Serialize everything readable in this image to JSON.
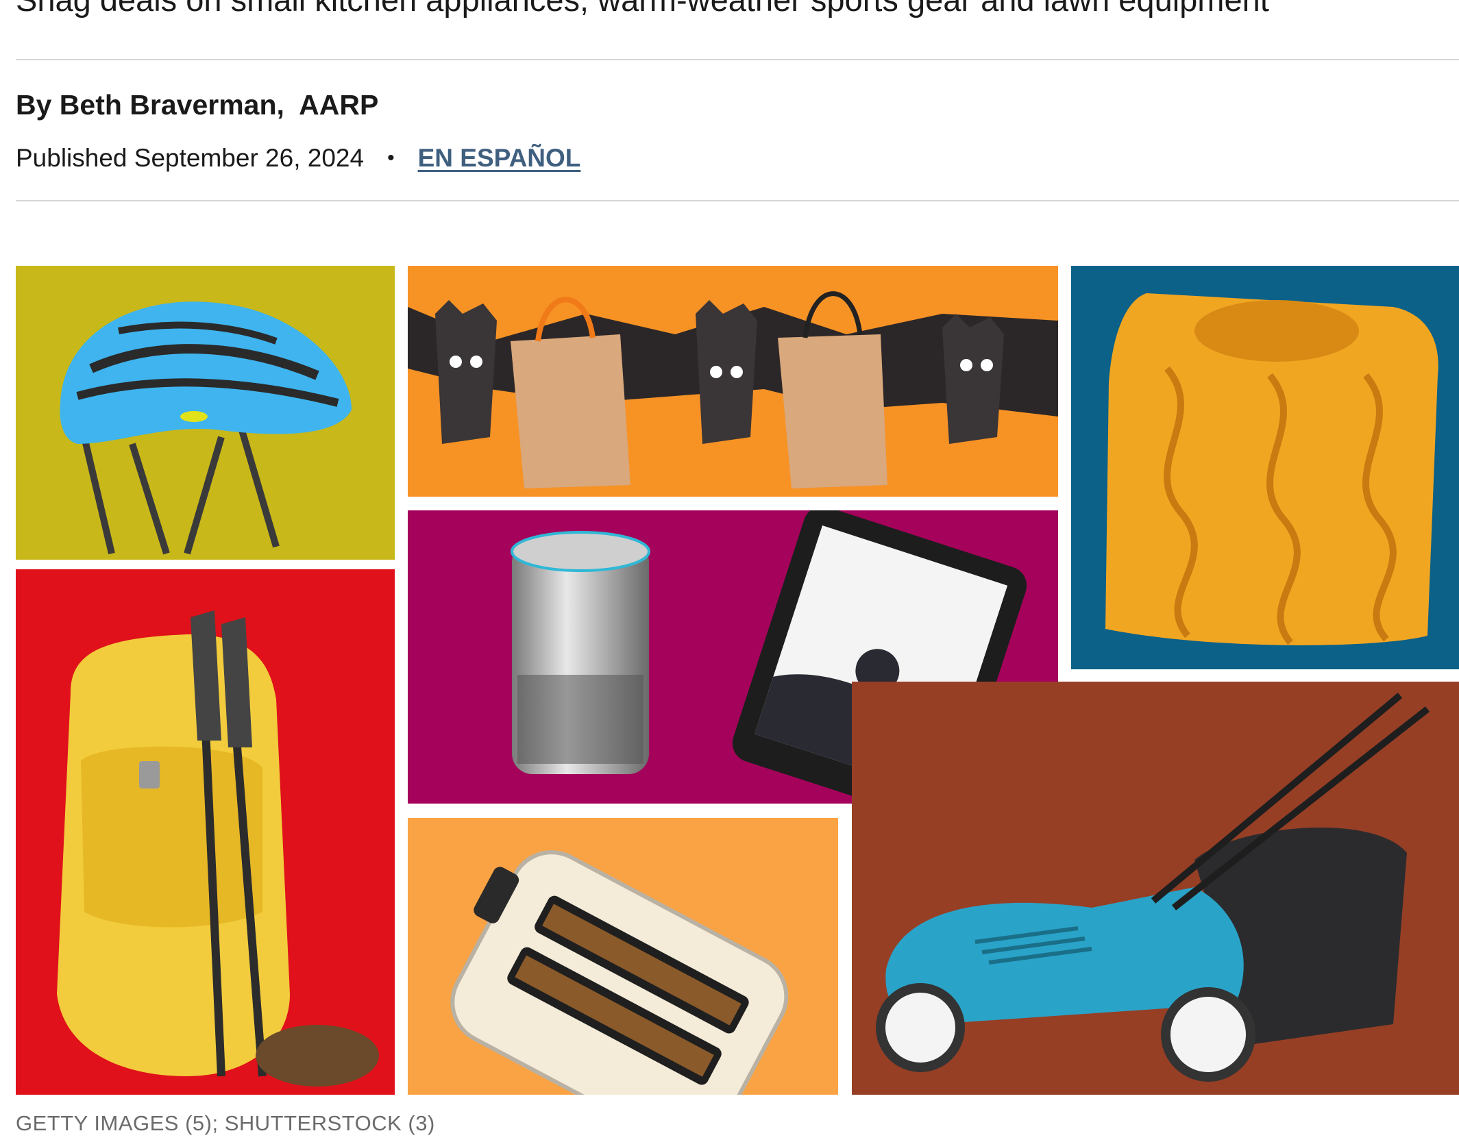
{
  "article": {
    "subheadline": "Snag deals on small kitchen appliances, warm-weather sports gear and lawn equipment",
    "byline": "By Beth Braverman,  AARP",
    "published": "Published September 26, 2024",
    "separator": "•",
    "language_link": "EN ESPAÑOL"
  },
  "image": {
    "credit": "GETTY IMAGES (5); SHUTTERSTOCK (3)"
  },
  "colors": {
    "helmet_bg": "#c9b819",
    "backpack_bg": "#e0111a",
    "bats_bg": "#f79225",
    "devices_bg": "#a5035b",
    "sweater_bg": "#0c6188",
    "toaster_bg": "#f9a344",
    "mower_bg": "#963f25",
    "link": "#3f5f7f"
  }
}
